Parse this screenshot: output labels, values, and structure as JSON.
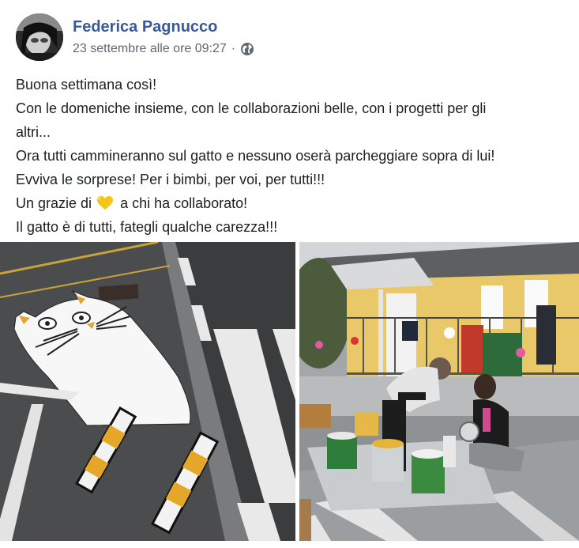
{
  "post": {
    "author": "Federica Pagnucco",
    "timestamp": "23 settembre alle ore 09:27",
    "separator": "·",
    "privacy_icon": "globe-icon",
    "text_lines": [
      "Buona settimana così!",
      "Con le domeniche insieme, con le collaborazioni belle, con i progetti per gli",
      "altri...",
      "Ora tutti cammineranno sul gatto e nessuno oserà parcheggiare sopra di lui!",
      "Evviva le sorprese! Per i bimbi, per voi, per tutti!!!"
    ],
    "thanks_before": "Un grazie di",
    "thanks_emoji": "yellow-heart-icon",
    "thanks_after": "a chi ha collaborato!",
    "last_line": "Il gatto è di tutti, fategli qualche carezza!!!"
  },
  "colors": {
    "author": "#385898",
    "meta": "#606770",
    "heart": "#f5c518"
  }
}
